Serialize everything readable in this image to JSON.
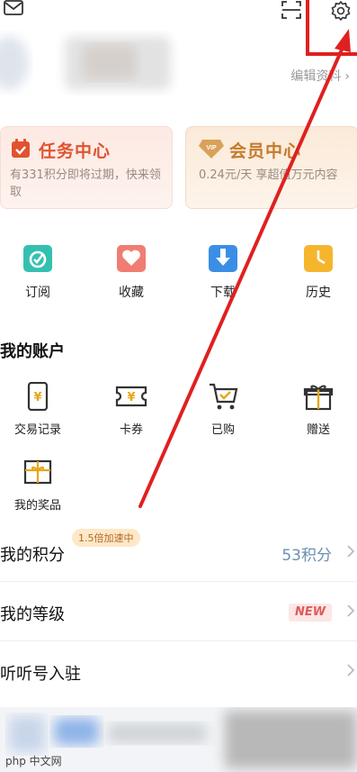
{
  "header": {
    "edit_profile": "编辑资料",
    "edit_chevron": "›"
  },
  "cards": {
    "task": {
      "title": "任务中心",
      "subtitle": "有331积分即将过期，快来领取"
    },
    "vip": {
      "title": "会员中心",
      "subtitle": "0.24元/天 享超值万元内容",
      "icon_text": "VIP"
    }
  },
  "quick": [
    {
      "label": "订阅",
      "icon": "subscribe-icon"
    },
    {
      "label": "收藏",
      "icon": "favorite-icon"
    },
    {
      "label": "下载",
      "icon": "download-icon"
    },
    {
      "label": "历史",
      "icon": "history-icon"
    }
  ],
  "account": {
    "title": "我的账户",
    "items": [
      {
        "label": "交易记录",
        "icon": "transaction-icon"
      },
      {
        "label": "卡券",
        "icon": "coupon-icon"
      },
      {
        "label": "已购",
        "icon": "purchased-icon"
      },
      {
        "label": "赠送",
        "icon": "gift-icon"
      },
      {
        "label": "我的奖品",
        "icon": "prize-icon"
      }
    ]
  },
  "rows": {
    "points": {
      "label": "我的积分",
      "badge": "1.5倍加速中",
      "value": "53积分"
    },
    "level": {
      "label": "我的等级",
      "tag": "NEW"
    },
    "creator": {
      "label": "听听号入驻"
    }
  },
  "watermark": "php 中文网",
  "colors": {
    "task_accent": "#e0532f",
    "vip_accent": "#c57a2c",
    "value_blue": "#6d8fb0",
    "annotation_red": "#e02020"
  }
}
